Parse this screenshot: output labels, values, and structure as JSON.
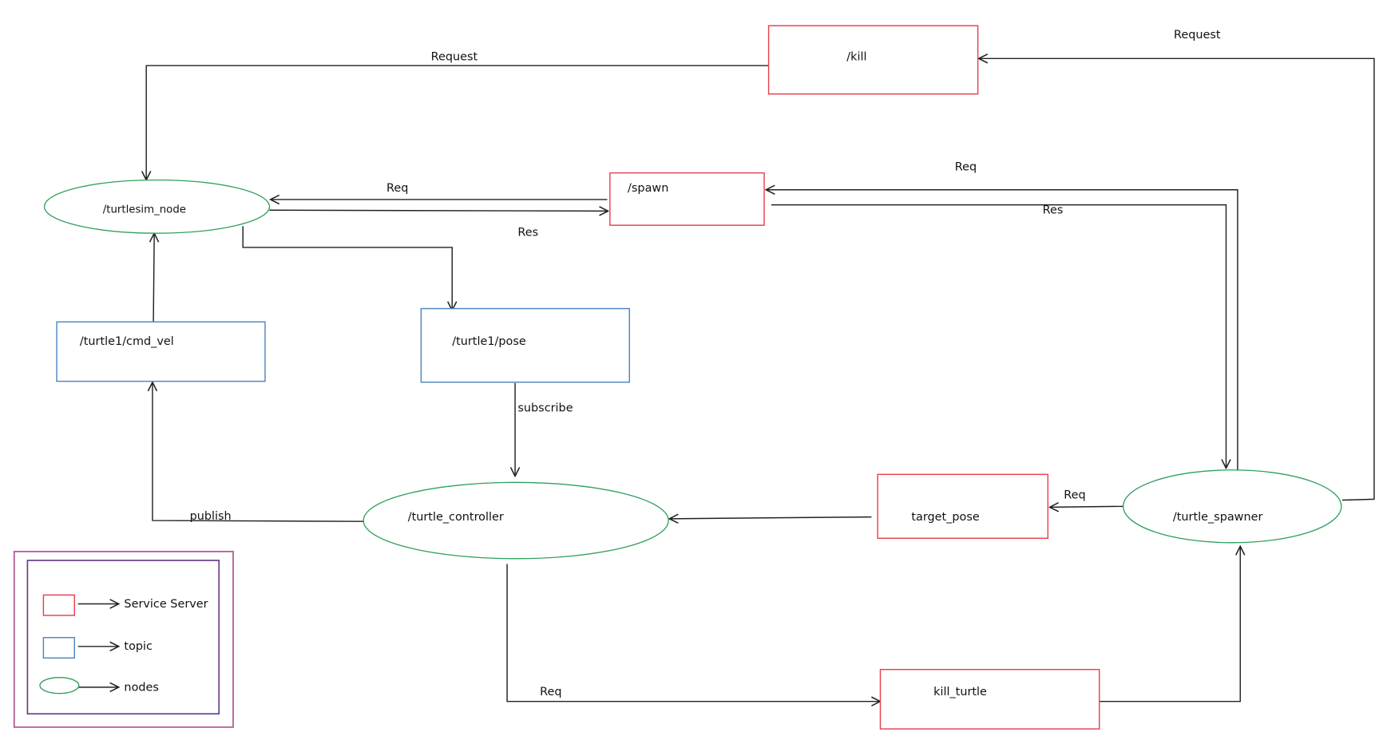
{
  "nodes": {
    "turtlesim_node": "/turtlesim_node",
    "turtle_controller": "/turtle_controller",
    "turtle_spawner": "/turtle_spawner"
  },
  "services": {
    "kill": "/kill",
    "spawn": "/spawn",
    "target_pose": "target_pose",
    "kill_turtle": "kill_turtle"
  },
  "topics": {
    "cmd_vel": "/turtle1/cmd_vel",
    "pose": "/turtle1/pose"
  },
  "edge_labels": {
    "kill_request_left": "Request",
    "kill_request_right": "Request",
    "spawn_req_left": "Req",
    "spawn_res_left": "Res",
    "spawn_req_right": "Req",
    "spawn_res_right": "Res",
    "subscribe": "subscribe",
    "publish": "publish",
    "target_pose_req": "Req",
    "kill_turtle_req": "Req"
  },
  "legend": {
    "service_server": "Service Server",
    "topic": "topic",
    "nodes": "nodes"
  },
  "colors": {
    "service": "#e8414e",
    "topic": "#4f86c0",
    "node": "#2ea05a"
  }
}
